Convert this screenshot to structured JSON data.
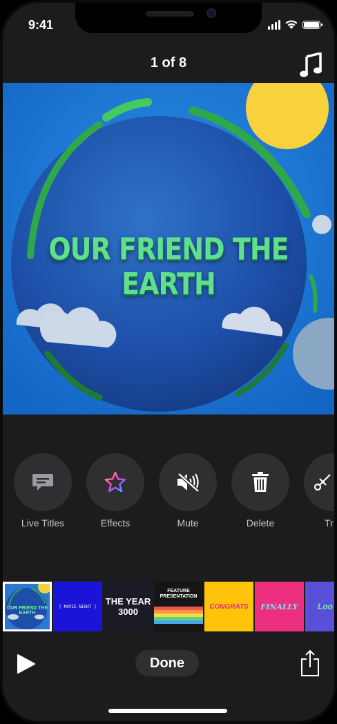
{
  "status": {
    "time": "9:41"
  },
  "header": {
    "title": "1 of 8",
    "music_icon": "music-note-icon"
  },
  "preview": {
    "title": "OUR FRIEND THE EARTH"
  },
  "actions": [
    {
      "label": "Live Titles",
      "icon": "speech-bubble-icon"
    },
    {
      "label": "Effects",
      "icon": "star-icon"
    },
    {
      "label": "Mute",
      "icon": "speaker-mute-icon"
    },
    {
      "label": "Delete",
      "icon": "trash-icon"
    },
    {
      "label": "Tr",
      "icon": "scissors-icon"
    }
  ],
  "timeline": {
    "clips": [
      {
        "text": "OUR FRIEND THE EARTH"
      },
      {
        "text": "[ MOVIE NIGHT ]"
      },
      {
        "text": "THE YEAR 3000"
      },
      {
        "text": "FEATURE PRESENTATION"
      },
      {
        "text": "CONGRATS"
      },
      {
        "text": "FINALLY"
      },
      {
        "text": "Loo"
      }
    ]
  },
  "footer": {
    "done_label": "Done",
    "play_icon": "play-icon",
    "share_icon": "share-icon"
  },
  "colors": {
    "background": "#1c1c1e",
    "button": "#2f2f31",
    "title_green": "#5fe08e"
  }
}
